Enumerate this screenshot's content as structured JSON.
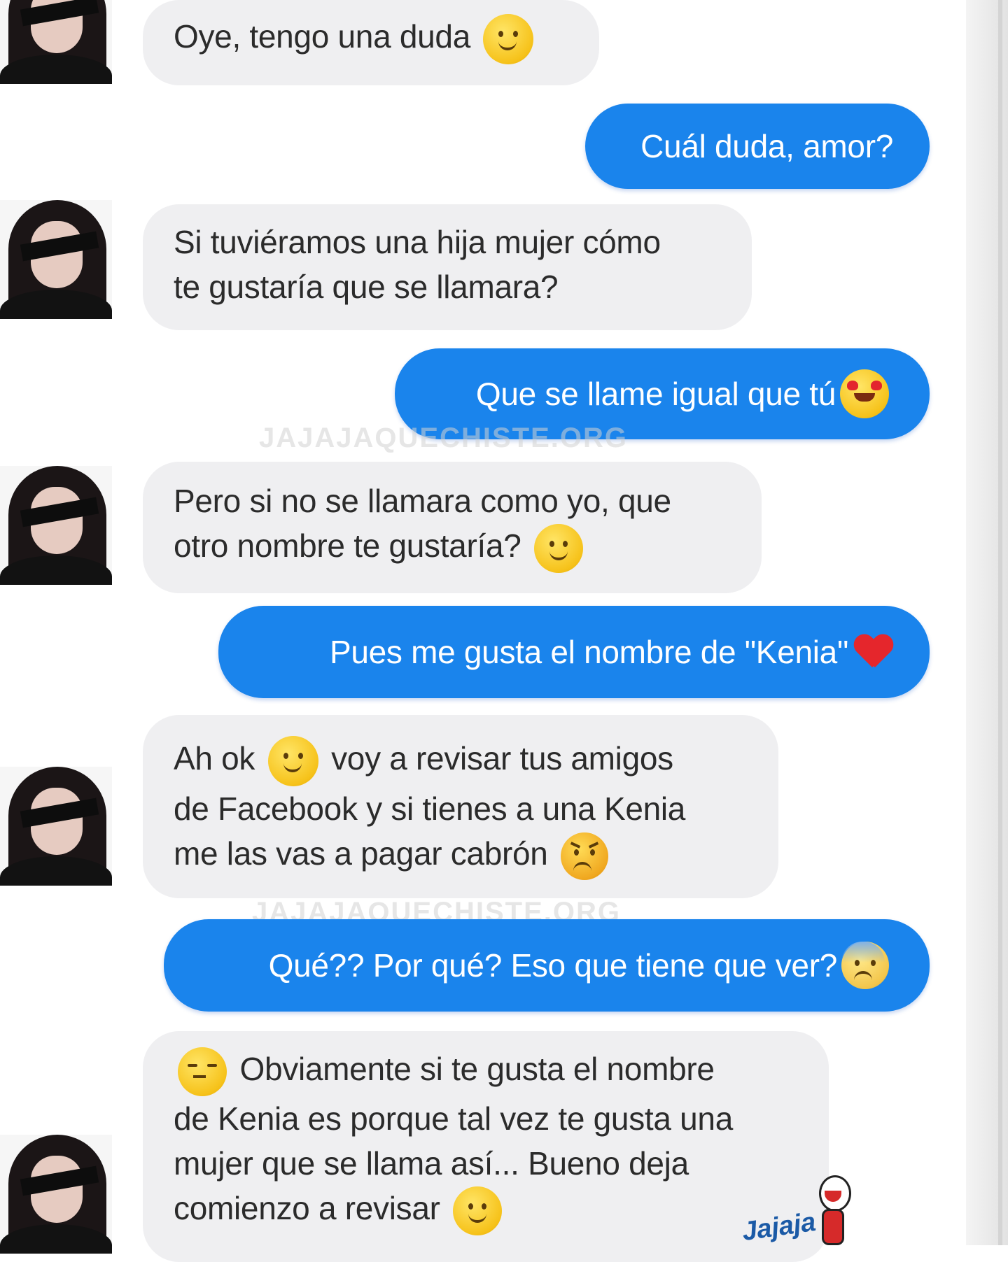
{
  "messages": [
    {
      "side": "in",
      "text": "Oye, tengo una duda",
      "emoji": "slight-smile-icon"
    },
    {
      "side": "out",
      "text": "Cuál duda, amor?"
    },
    {
      "side": "in",
      "text": "Si tuviéramos una hija mujer cómo\nte gustaría que se llamara?"
    },
    {
      "side": "out",
      "text": "Que se llame igual que tú",
      "emoji": "heart-eyes-icon"
    },
    {
      "side": "in",
      "text": "Pero si no se llamara como yo, que\notro nombre te gustaría?",
      "emoji": "slight-smile-icon"
    },
    {
      "side": "out",
      "text": "Pues me gusta el nombre de \"Kenia\"",
      "emoji": "heart-icon"
    },
    {
      "side": "in",
      "text_a": "Ah ok",
      "text_b": "voy a revisar tus amigos",
      "text_c": "de Facebook y si tienes a una Kenia\nme las vas a pagar cabrón",
      "emoji_a": "slight-smile-icon",
      "emoji_b": "angry-face-icon"
    },
    {
      "side": "out",
      "text": "Qué?? Por qué? Eso que tiene que ver?",
      "emoji": "worried-face-icon"
    },
    {
      "side": "in",
      "text_a": "Obviamente si te gusta el nombre",
      "text_b": "de Kenia es porque tal vez te gusta una\nmujer que se llama así... Bueno deja\ncomienzo a revisar",
      "emoji_a": "unamused-face-icon",
      "emoji_b": "slight-smile-icon"
    }
  ],
  "watermark": "JAJAJAQUECHISTE.ORG",
  "logo_text": "Jajaja",
  "colors": {
    "incoming_bubble": "#efeff1",
    "outgoing_bubble": "#1a84ec",
    "outgoing_text": "#ffffff",
    "incoming_text": "#2b2b2b"
  }
}
